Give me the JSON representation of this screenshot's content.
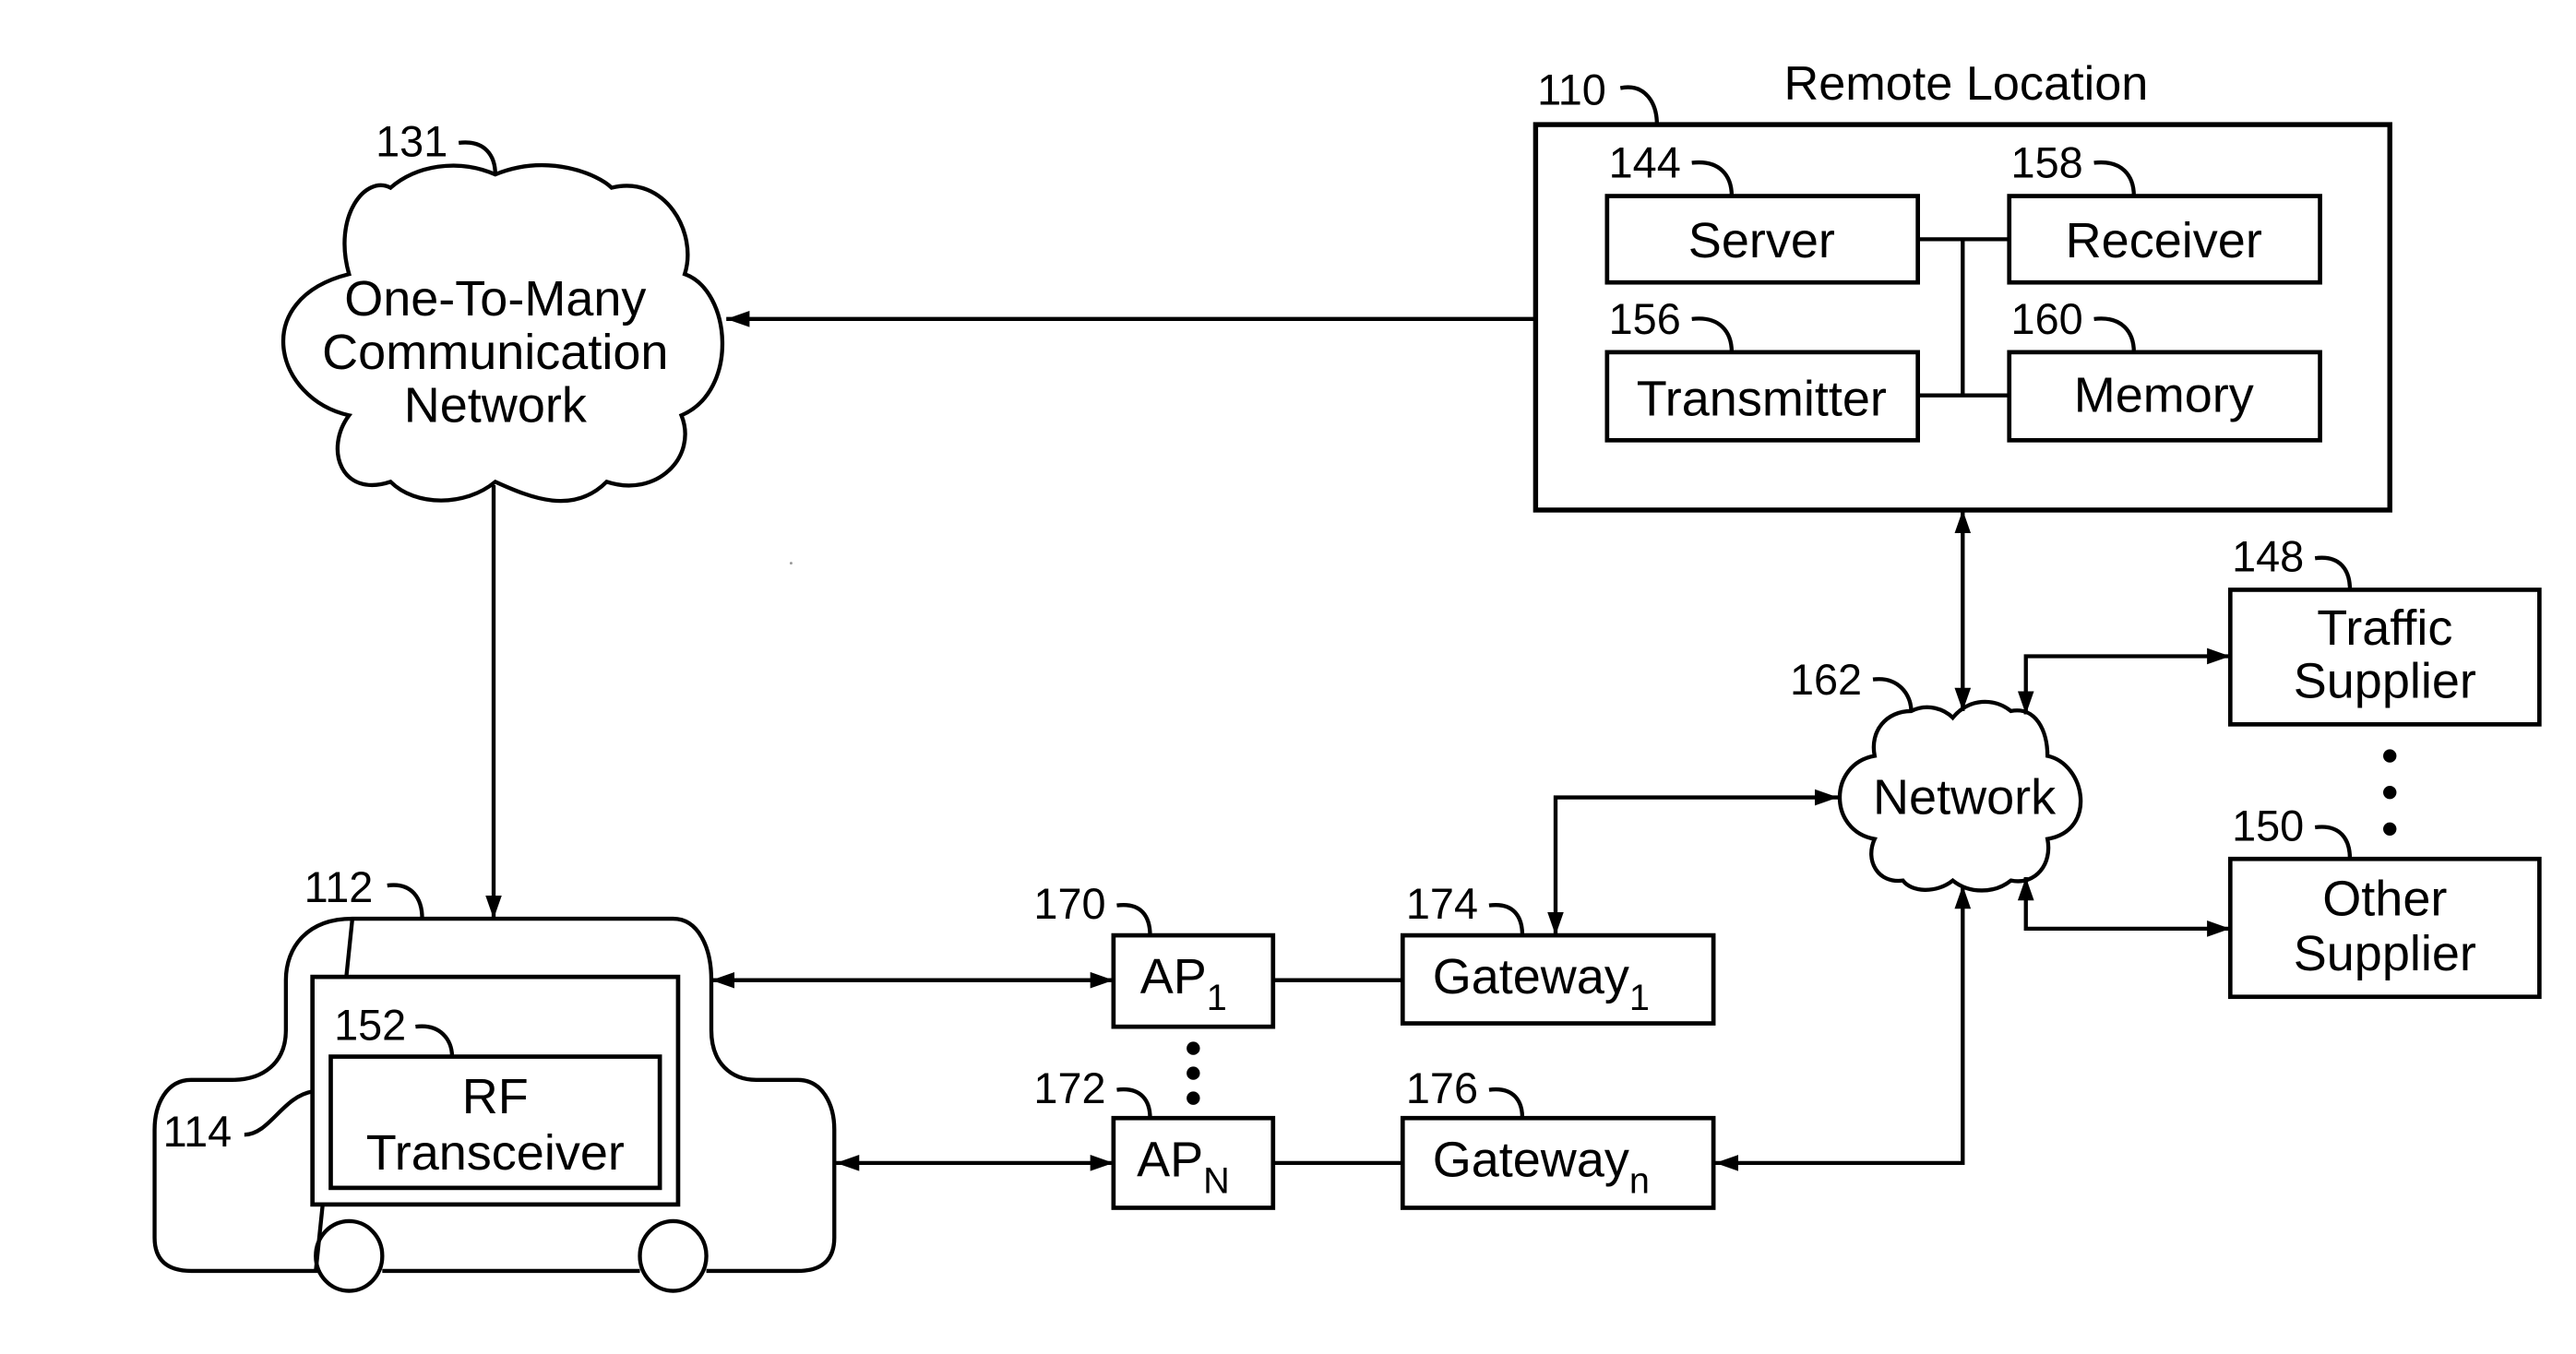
{
  "remote_location": {
    "title": "Remote Location",
    "ref": "110",
    "server": {
      "label": "Server",
      "ref": "144"
    },
    "receiver": {
      "label": "Receiver",
      "ref": "158"
    },
    "transmitter": {
      "label": "Transmitter",
      "ref": "156"
    },
    "memory": {
      "label": "Memory",
      "ref": "160"
    }
  },
  "one_to_many": {
    "ref": "131",
    "lines": [
      "One-To-Many",
      "Communication",
      "Network"
    ]
  },
  "vehicle": {
    "ref": "112",
    "unit_ref": "114",
    "rf": {
      "ref": "152",
      "lines": [
        "RF",
        "Transceiver"
      ]
    }
  },
  "access_points": [
    {
      "ref": "170",
      "label": "AP",
      "subscript": "1"
    },
    {
      "ref": "172",
      "label": "AP",
      "subscript": "N"
    }
  ],
  "gateways": [
    {
      "ref": "174",
      "label": "Gateway",
      "subscript": "1"
    },
    {
      "ref": "176",
      "label": "Gateway",
      "subscript": "n"
    }
  ],
  "network": {
    "ref": "162",
    "label": "Network"
  },
  "suppliers": [
    {
      "ref": "148",
      "lines": [
        "Traffic",
        "Supplier"
      ]
    },
    {
      "ref": "150",
      "lines": [
        "Other",
        "Supplier"
      ]
    }
  ],
  "colors": {
    "ink": "#000000",
    "background": "#ffffff"
  }
}
